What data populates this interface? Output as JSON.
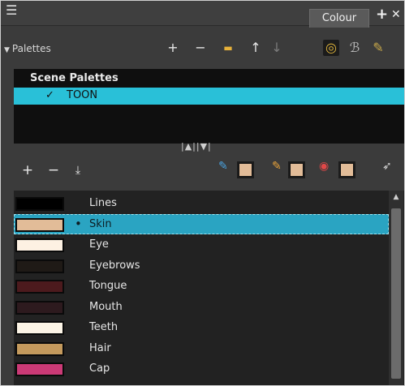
{
  "window": {
    "tab_label": "Colour",
    "add_tab_glyph": "+",
    "close_glyph": "✕",
    "menu_glyph": "☰"
  },
  "palettes": {
    "header_label": "Palettes",
    "toolbar": [
      {
        "name": "add-palette-icon",
        "glyph": "+"
      },
      {
        "name": "remove-palette-icon",
        "glyph": "−"
      },
      {
        "name": "folder-icon",
        "glyph": "▬"
      },
      {
        "name": "move-up-icon",
        "glyph": "↑"
      },
      {
        "name": "move-down-icon",
        "glyph": "↓"
      },
      {
        "name": "palette-lock-icon",
        "glyph": "◎"
      },
      {
        "name": "edit-palette-icon",
        "glyph": "ℬ"
      },
      {
        "name": "palette-options-icon",
        "glyph": "✎"
      }
    ],
    "scene_title": "Scene Palettes",
    "active_palette": "TOON",
    "check_glyph": "✓",
    "splitter_glyph": "|▲||▼|"
  },
  "colour_toolbar": [
    {
      "name": "add-colour-icon",
      "glyph": "+"
    },
    {
      "name": "remove-colour-icon",
      "glyph": "−"
    },
    {
      "name": "add-texture-icon",
      "glyph": "⤓"
    }
  ],
  "accent_colors": {
    "selection": "#2aa4c2",
    "palette_selection": "#29c0d8",
    "mini_swatch": "#e2bc98"
  },
  "colours": [
    {
      "name": "Lines",
      "color": "#000000"
    },
    {
      "name": "Skin",
      "color": "#e2bc98",
      "selected": true
    },
    {
      "name": "Eye",
      "color": "#fdf1e3"
    },
    {
      "name": "Eyebrows",
      "color": "#1f1a16"
    },
    {
      "name": "Tongue",
      "color": "#4c1a1d"
    },
    {
      "name": "Mouth",
      "color": "#2d1a1e"
    },
    {
      "name": "Teeth",
      "color": "#fcf4e6"
    },
    {
      "name": "Hair",
      "color": "#c49a5d"
    },
    {
      "name": "Cap",
      "color": "#cb3a76"
    }
  ]
}
